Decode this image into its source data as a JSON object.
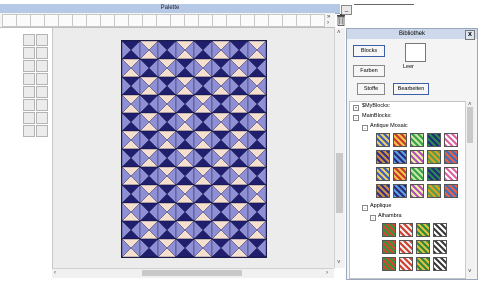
{
  "palette": {
    "title": "Palette",
    "close_label": "_",
    "scroll_arrows": "»\n›"
  },
  "library": {
    "title": "Bibliothek",
    "close_label": "x",
    "buttons": {
      "blocks": "Blocks",
      "colors": "Farben",
      "fabrics": "Stoffe",
      "edit": "Bearbeiten"
    },
    "preview_label": "Leer",
    "tree": {
      "my_blocks": "$MyBlocks:",
      "main_blocks": "MainBlocks:",
      "antique_mosaic": "Antique Mosaic",
      "applique": "Applique",
      "alhambra": "Alhambra"
    }
  },
  "colors": {
    "quilt_dark": "#1f1f6e",
    "quilt_medium": "#8e8fd4",
    "quilt_light": "#f5dfcf",
    "quilt_outline": "#101040"
  },
  "icons": [
    "trash-icon",
    "tool-icons",
    "tree-toggle-icon",
    "scroll-arrow-icon"
  ]
}
